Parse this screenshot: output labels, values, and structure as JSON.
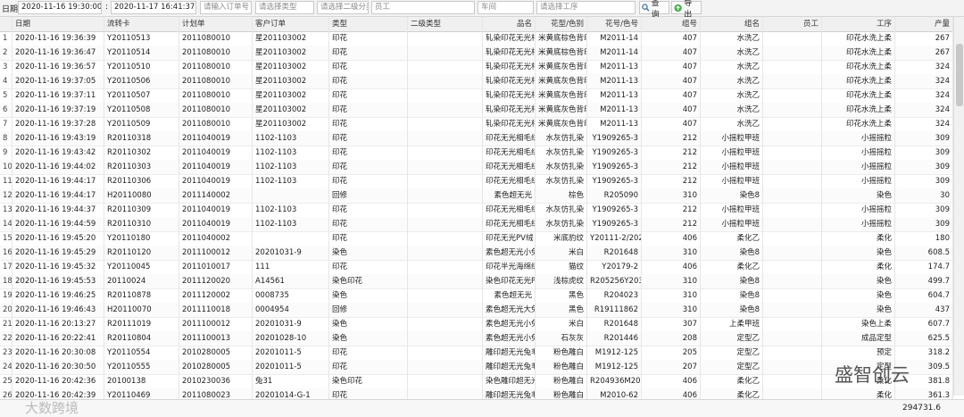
{
  "toolbar": {
    "date_label": "日期:",
    "date_from": "2020-11-16 19:30:00",
    "date_sep": ":",
    "date_to": "2020-11-17 16:41:37",
    "order_ph": "请输入订单号",
    "type_ph": "请选择类型",
    "subtype_ph": "请选择二级分类",
    "employee_ph": "员工",
    "workshop_ph": "车间",
    "process_ph": "请选择工序",
    "query_label": "查询",
    "export_label": "导出"
  },
  "columns": [
    "",
    "日期",
    "流转卡",
    "计划单",
    "客户订单",
    "类型",
    "二级类型",
    "品名",
    "花型/色别",
    "花号/色号",
    "组号",
    "组名",
    "员工",
    "工序",
    "产量"
  ],
  "rows": [
    [
      "1",
      "2020-11-16 19:36:39",
      "Y20110513",
      "2011080010",
      "星201103002",
      "印花",
      "",
      "轧染印花无光相",
      "米黄底棕色背印",
      "M2011-14",
      "407",
      "水洗乙",
      "",
      "印花水洗上柔",
      "267"
    ],
    [
      "2",
      "2020-11-16 19:36:47",
      "Y20110514",
      "2011080010",
      "星201103002",
      "印花",
      "",
      "轧染印花无光相",
      "米黄底棕色背印",
      "M2011-14",
      "407",
      "水洗乙",
      "",
      "印花水洗上柔",
      "267"
    ],
    [
      "3",
      "2020-11-16 19:36:57",
      "Y20110510",
      "2011080010",
      "星201103002",
      "印花",
      "",
      "轧染印花无光相",
      "米黄底灰色背印",
      "M2011-13",
      "407",
      "水洗乙",
      "",
      "印花水洗上柔",
      "324"
    ],
    [
      "4",
      "2020-11-16 19:37:05",
      "Y20110506",
      "2011080010",
      "星201103002",
      "印花",
      "",
      "轧染印花无光相",
      "米黄底灰色背印",
      "M2011-13",
      "407",
      "水洗乙",
      "",
      "印花水洗上柔",
      "324"
    ],
    [
      "5",
      "2020-11-16 19:37:11",
      "Y20110507",
      "2011080010",
      "星201103002",
      "印花",
      "",
      "轧染印花无光相",
      "米黄底灰色背印",
      "M2011-13",
      "407",
      "水洗乙",
      "",
      "印花水洗上柔",
      "324"
    ],
    [
      "6",
      "2020-11-16 19:37:19",
      "Y20110508",
      "2011080010",
      "星201103002",
      "印花",
      "",
      "轧染印花无光相",
      "米黄底灰色背印",
      "M2011-13",
      "407",
      "水洗乙",
      "",
      "印花水洗上柔",
      "324"
    ],
    [
      "7",
      "2020-11-16 19:37:28",
      "Y20110509",
      "2011080010",
      "星201103002",
      "印花",
      "",
      "轧染印花无光相",
      "米黄底灰色背印",
      "M2011-13",
      "407",
      "水洗乙",
      "",
      "印花水洗上柔",
      "324"
    ],
    [
      "8",
      "2020-11-16 19:43:19",
      "R20110318",
      "2011040019",
      "1102-1103",
      "印花",
      "",
      "印花无光相毛绒",
      "水灰仿扎染",
      "Y1909265-3",
      "212",
      "小摇粒甲班",
      "",
      "小摇摇粒",
      "309"
    ],
    [
      "9",
      "2020-11-16 19:43:42",
      "R20110302",
      "2011040019",
      "1102-1103",
      "印花",
      "",
      "印花无光相毛绒",
      "水灰仿扎染",
      "Y1909265-3",
      "212",
      "小摇粒甲班",
      "",
      "小摇摇粒",
      "309"
    ],
    [
      "10",
      "2020-11-16 19:44:02",
      "R20110303",
      "2011040019",
      "1102-1103",
      "印花",
      "",
      "印花无光相毛绒",
      "水灰仿扎染",
      "Y1909265-3",
      "212",
      "小摇粒甲班",
      "",
      "小摇摇粒",
      "309"
    ],
    [
      "11",
      "2020-11-16 19:44:17",
      "R20110306",
      "2011040019",
      "1102-1103",
      "印花",
      "",
      "印花无光相毛绒",
      "水灰仿扎染",
      "Y1909265-3",
      "212",
      "小摇粒甲班",
      "",
      "小摇摇粒",
      "309"
    ],
    [
      "12",
      "2020-11-16 19:44:17",
      "H20110080",
      "2011140002",
      "",
      "回修",
      "",
      "素色超无光",
      "棕色",
      "R205090",
      "310",
      "染色8",
      "",
      "染色",
      "30"
    ],
    [
      "13",
      "2020-11-16 19:44:37",
      "R20110309",
      "2011040019",
      "1102-1103",
      "印花",
      "",
      "印花无光相毛绒",
      "水灰仿扎染",
      "Y1909265-3",
      "212",
      "小摇粒甲班",
      "",
      "小摇摇粒",
      "309"
    ],
    [
      "14",
      "2020-11-16 19:44:59",
      "R20110310",
      "2011040019",
      "1102-1103",
      "印花",
      "",
      "印花无光相毛绒",
      "水灰仿扎染",
      "Y1909265-3",
      "212",
      "小摇粒甲班",
      "",
      "小摇摇粒",
      "309"
    ],
    [
      "15",
      "2020-11-16 19:45:20",
      "Y20110180",
      "2011040002",
      "",
      "印花",
      "",
      "印花无光PV绒",
      "米底豹纹",
      "Y20111-2/2020",
      "406",
      "柔化乙",
      "",
      "柔化",
      "180"
    ],
    [
      "16",
      "2020-11-16 19:45:29",
      "R20110120",
      "2011100012",
      "20201031-9",
      "染色",
      "",
      "素色超无光小兔",
      "米白",
      "R201648",
      "310",
      "染色8",
      "",
      "染色",
      "608.5"
    ],
    [
      "17",
      "2020-11-16 19:45:32",
      "Y20110045",
      "2011010017",
      "111",
      "印花",
      "",
      "印花半光海绵绒",
      "猫纹",
      "Y20179-2",
      "406",
      "柔化乙",
      "",
      "柔化",
      "174.7"
    ],
    [
      "18",
      "2020-11-16 19:45:53",
      "20110024",
      "2011120020",
      "A14561",
      "染色印花",
      "",
      "染色印花无光PV",
      "浅棕虎纹",
      "R205256Y20321",
      "310",
      "染色8",
      "",
      "染色",
      "499.7"
    ],
    [
      "19",
      "2020-11-16 19:46:25",
      "R20110878",
      "2011120002",
      "0008735",
      "染色",
      "",
      "素色超无光",
      "黑色",
      "R204023",
      "310",
      "染色8",
      "",
      "染色",
      "604.7"
    ],
    [
      "20",
      "2020-11-16 19:46:43",
      "H20110070",
      "2011110018",
      "0004954",
      "回修",
      "",
      "素色超无光大兔",
      "黑色",
      "R19111862",
      "310",
      "染色8",
      "",
      "染色",
      "437"
    ],
    [
      "21",
      "2020-11-16 20:13:27",
      "R20111019",
      "2011100012",
      "20201031-9",
      "染色",
      "",
      "素色超无光小兔",
      "米白",
      "R201648",
      "307",
      "上柔甲班",
      "",
      "染色上柔",
      "607.7"
    ],
    [
      "22",
      "2020-11-16 20:22:41",
      "R20110804",
      "2011100013",
      "20201028-10",
      "染色",
      "",
      "素色超无光小兔",
      "石灰灰",
      "R201446",
      "208",
      "定型乙",
      "",
      "成品定型",
      "625.5"
    ],
    [
      "23",
      "2020-11-16 20:30:08",
      "Y20110554",
      "2010280005",
      "20201011-5",
      "印花",
      "",
      "雕印超无光兔毛",
      "粉色雕白",
      "M1912-125",
      "205",
      "定型乙",
      "",
      "预定",
      "318.2"
    ],
    [
      "24",
      "2020-11-16 20:30:50",
      "Y20110555",
      "2010280005",
      "20201011-5",
      "印花",
      "",
      "雕印超无光兔毛",
      "粉色雕白",
      "M1912-125",
      "207",
      "定型乙",
      "",
      "定型",
      "309.5"
    ],
    [
      "25",
      "2020-11-16 20:42:36",
      "20100138",
      "2010230036",
      "兔31",
      "染色印花",
      "",
      "染色雕印超无光",
      "粉色雕白",
      "R204936M2010",
      "406",
      "柔化乙",
      "",
      "柔化",
      "381.8"
    ],
    [
      "26",
      "2020-11-16 20:42:39",
      "Y20110469",
      "2011080023",
      "20201014-G-1",
      "印花",
      "",
      "雕印超无光兔毛",
      "粉色雕白",
      "M2010-62",
      "406",
      "柔化乙",
      "",
      "柔化",
      "361.3"
    ]
  ],
  "footer": {
    "total": "294731.6"
  },
  "watermarks": {
    "right": "盛智创云",
    "left": "大数跨境"
  }
}
